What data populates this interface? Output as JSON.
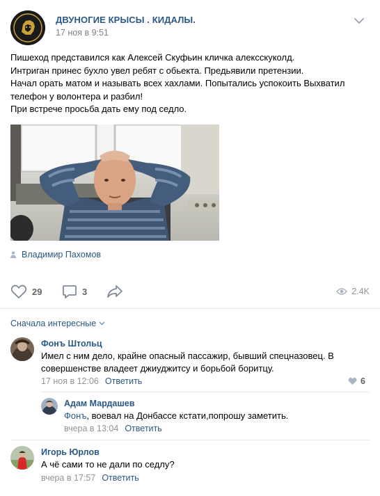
{
  "post": {
    "group_name": "ДВУНОГИЕ КРЫСЫ . КИДАЛЫ.",
    "date": "17 ноя в 9:51",
    "text_lines": [
      "Пишеход представился как Алексей Скуфьин кличка алексскуколд.",
      "Интриган принес бухло увел ребят с обьекта. Предьявили претензии.",
      "Начал орать матом и называть всех хахлами. Попытались успокоить Выхватил",
      "телефон у волонтера и разбил!",
      "При встрече просьба дать ему под седло."
    ],
    "author_name": "Владимир Пахомов",
    "likes": "29",
    "comments": "3",
    "views": "2.4K"
  },
  "comments_section": {
    "sort_label": "Сначала интересные",
    "items": [
      {
        "name": "Фонъ Штольц",
        "text_lines": [
          "Имел с ним дело, крайне опасный пассажир, бывший спецназовец. В",
          "совершенстве владеет джиуджитсу и борьбой боритцу."
        ],
        "date": "17 ноя в 12:06",
        "reply": "Ответить",
        "likes": "6"
      },
      {
        "name": "Адам Мардашев",
        "mention": "Фонъ",
        "text": ", воевал на Донбассе кстати,попрошу заметить.",
        "date": "вчера в 13:04",
        "reply": "Ответить"
      },
      {
        "name": "Игорь Юрлов",
        "text": "А чё сами то не дали по седлу?",
        "date": "вчера в 17:57",
        "reply": "Ответить"
      }
    ]
  },
  "colors": {
    "link": "#2a5885",
    "meta": "#939393",
    "counter": "#656565",
    "divider": "#e7e8ec"
  },
  "icons": [
    "lion-logo-icon",
    "chevron-down-icon",
    "person-icon",
    "heart-icon",
    "comment-icon",
    "share-icon",
    "eye-icon"
  ]
}
